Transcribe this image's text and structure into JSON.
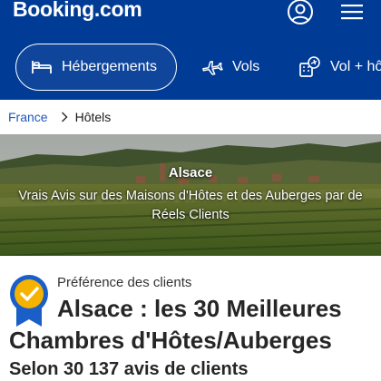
{
  "header": {
    "logo": "Booking.com",
    "icons": {
      "account": "user-circle-icon",
      "menu": "hamburger-menu-icon"
    }
  },
  "nav": {
    "items": [
      {
        "label": "Hébergements",
        "icon": "bed-icon",
        "active": true
      },
      {
        "label": "Vols",
        "icon": "airplane-icon",
        "active": false
      },
      {
        "label": "Vol + hô",
        "icon": "flight-hotel-icon",
        "active": false
      }
    ]
  },
  "breadcrumb": {
    "items": [
      "France",
      "Hôtels"
    ]
  },
  "hero": {
    "title": "Alsace",
    "subtitle": "Vrais Avis sur des Maisons d'Hôtes et des Auberges par de Réels Clients"
  },
  "content": {
    "badge_icon": "award-check-badge-icon",
    "preference_label": "Préférence des clients",
    "headline_line1": "Alsace : les 30 Meilleures",
    "headline_line2": "Chambres d'Hôtes/Auberges",
    "subhead": "Selon 30 137 avis de clients"
  },
  "colors": {
    "brand_blue": "#003b95",
    "link_blue": "#1f57c3",
    "badge_blue": "#1a5fc8",
    "badge_gold": "#f5b300"
  }
}
